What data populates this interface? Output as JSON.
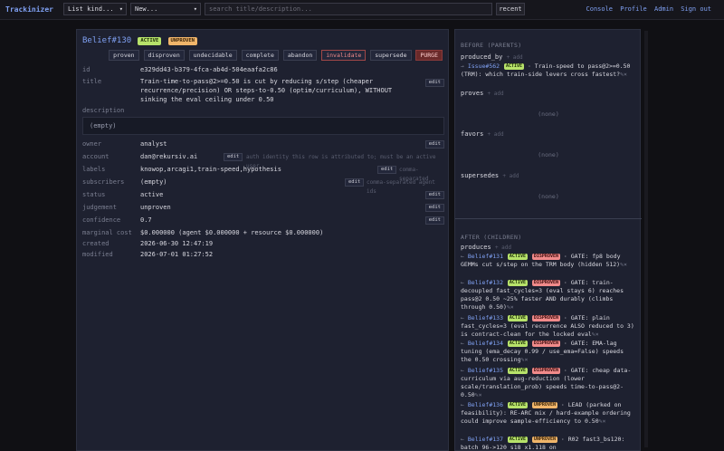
{
  "topbar": {
    "brand": "Trackinizer",
    "kind_select": "List kind...",
    "new_select": "New...",
    "search_placeholder": "search title/description...",
    "recent_label": "recent",
    "nav": [
      "Console",
      "Profile",
      "Admin",
      "Sign out"
    ]
  },
  "object": {
    "title": "Belief#130",
    "badges": [
      "ACTIVE",
      "UNPROVEN"
    ],
    "actions": [
      "proven",
      "disproven",
      "undecidable",
      "complete",
      "abandon",
      "invalidate",
      "supersede",
      "PURGE"
    ],
    "fields": {
      "id_label": "id",
      "id_value": "e329dd43-b379-4fca-ab4d-504eaafa2c86",
      "title_label": "title",
      "title_value": "Train-time-to-pass@2>=0.50 is cut by reducing s/step (cheaper\nrecurrence/precision) OR steps-to-0.50 (optim/curriculum), WITHOUT\nsinking the eval ceiling under 0.50",
      "description_label": "description",
      "description_value": "(empty)",
      "owner_label": "owner",
      "owner_value": "analyst",
      "account_label": "account",
      "account_value": "dan@rekursiv.ai",
      "account_hint": "auth identity this row is attributed to; must be an active user",
      "labels_label": "labels",
      "labels_value": "knowop,arcagi1,train-speed,hypothesis",
      "labels_hint": "comma-separated",
      "subscribers_label": "subscribers",
      "subscribers_value": "(empty)",
      "subscribers_hint": "comma-separated agent ids",
      "status_label": "status",
      "status_value": "active",
      "judgement_label": "judgement",
      "judgement_value": "unproven",
      "confidence_label": "confidence",
      "confidence_value": "0.7",
      "marginal_label": "marginal cost",
      "marginal_value": "$0.000000 (agent $0.000000 + resource $0.000000)",
      "created_label": "created",
      "created_value": "2026-06-30 12:47:19",
      "modified_label": "modified",
      "modified_value": "2026-07-01 01:27:52",
      "edit_label": "edit"
    }
  },
  "before": {
    "heading": "BEFORE (PARENTS)",
    "add_label": "+ add",
    "produced_by_label": "produced_by",
    "produced_by_item": {
      "arrow": "→",
      "link": "Issue#562",
      "badge": "ACTIVE",
      "text": " · Train-speed to pass@2>=0.50 (TRM): which train-side levers cross fastest?",
      "marks": "✎×"
    },
    "proves_label": "proves",
    "proves_none": "(none)",
    "favors_label": "favors",
    "favors_none": "(none)",
    "supersedes_label": "supersedes",
    "supersedes_none": "(none)"
  },
  "after": {
    "heading": "AFTER (CHILDREN)",
    "produces_label": "produces",
    "add_label": "+ add",
    "items": [
      {
        "link": "Belief#131",
        "badges": [
          "ACTIVE",
          "DISPROVEN"
        ],
        "text": " · GATE: fp8 body GEMMs cut s/step on the TRM body (hidden 512)",
        "marks": "✎×"
      },
      {
        "link": "Belief#132",
        "badges": [
          "ACTIVE",
          "DISPROVEN"
        ],
        "text": " · GATE: train-decoupled fast_cycles=3 (eval stays 6) reaches pass@2 0.50 ~25% faster AND durably (climbs through 0.50)",
        "marks": "✎×"
      },
      {
        "link": "Belief#133",
        "badges": [
          "ACTIVE",
          "DISPROVEN"
        ],
        "text": " · GATE: plain fast_cycles=3 (eval recurrence ALSO reduced to 3) is contract-clean for the locked eval",
        "marks": "✎×"
      },
      {
        "link": "Belief#134",
        "badges": [
          "ACTIVE",
          "DISPROVEN"
        ],
        "text": " · GATE: EMA-lag tuning (ema_decay 0.99 / use_ema=False) speeds the 0.50 crossing",
        "marks": "✎×"
      },
      {
        "link": "Belief#135",
        "badges": [
          "ACTIVE",
          "DISPROVEN"
        ],
        "text": " · GATE: cheap data-curriculum via aug-reduction (lower scale/translation_prob) speeds time-to-pass@2-0.50",
        "marks": "✎×"
      },
      {
        "link": "Belief#136",
        "badges": [
          "ACTIVE",
          "UNPROVEN"
        ],
        "text": " · LEAD (parked on feasibility): RE-ARC mix / hard-example ordering could improve sample-efficiency to 0.50",
        "marks": "✎×"
      },
      {
        "link": "Belief#137",
        "badges": [
          "ACTIVE",
          "UNPROVEN"
        ],
        "text": " · R02 fast3_bs120: batch 96->120 s18 x1.118 on",
        "marks": ""
      }
    ]
  },
  "colors": {
    "bg": "#101014",
    "panel": "#1e2130",
    "link": "#7fa0f2",
    "active": "#b7e26a",
    "unproven": "#f0b56a",
    "disproven": "#f08a8a"
  }
}
